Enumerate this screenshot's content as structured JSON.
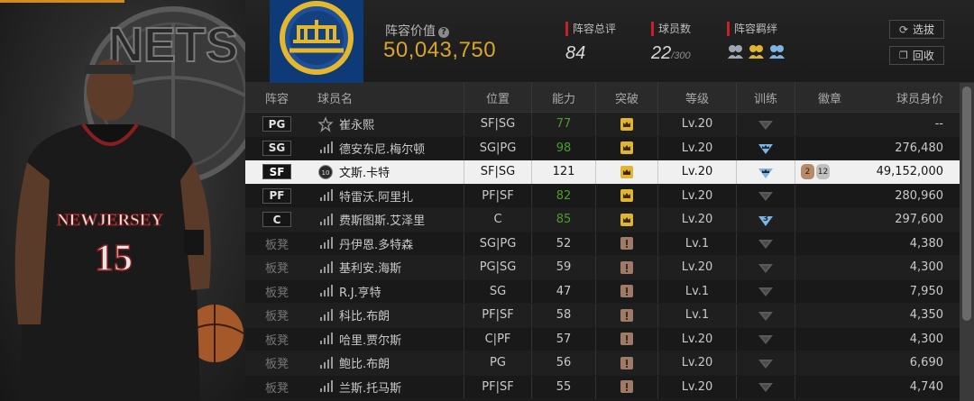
{
  "header": {
    "value_label": "阵容价值",
    "value": "50,043,750",
    "total_rating_label": "阵容总评",
    "total_rating": "84",
    "player_count_label": "球员数",
    "player_count": "22",
    "player_count_max": "/300",
    "bond_label": "阵容羁绊",
    "filter_button": "选拔",
    "recycle_button": "回收"
  },
  "hero": {
    "team_text": "NETS",
    "jersey_team": "NEWJERSEY",
    "jersey_number": "15"
  },
  "table": {
    "headers": [
      "阵容",
      "球员名",
      "位置",
      "能力",
      "突破",
      "等级",
      "训练",
      "徽章",
      "球员身价"
    ],
    "rows": [
      {
        "slot": "PG",
        "name": "崔永熙",
        "pos": "SF|SG",
        "ability": "77",
        "level": "Lv.20",
        "value": "--",
        "ability_color": "green",
        "break": "gold",
        "train": "grey"
      },
      {
        "slot": "SG",
        "name": "德安东尼.梅尔顿",
        "pos": "SG|PG",
        "ability": "98",
        "level": "Lv.20",
        "value": "276,480",
        "ability_color": "green",
        "break": "gold",
        "train": "blue"
      },
      {
        "slot": "SF",
        "name": "文斯.卡特",
        "pos": "SF|SG",
        "ability": "121",
        "level": "Lv.20",
        "value": "49,152,000",
        "ability_color": "dark",
        "break": "gold",
        "train": "blue",
        "selected": true,
        "badges": [
          "2",
          "12"
        ]
      },
      {
        "slot": "PF",
        "name": "特雷沃.阿里扎",
        "pos": "PF|SF",
        "ability": "82",
        "level": "Lv.20",
        "value": "280,960",
        "ability_color": "green",
        "break": "gold",
        "train": "grey"
      },
      {
        "slot": "C",
        "name": "费斯图斯.艾泽里",
        "pos": "C",
        "ability": "85",
        "level": "Lv.20",
        "value": "297,600",
        "ability_color": "green",
        "break": "gold",
        "train": "blue3",
        "train_text": "3"
      },
      {
        "slot": "板凳",
        "name": "丹伊恩.多特森",
        "pos": "SG|PG",
        "ability": "52",
        "level": "Lv.1",
        "value": "4,380",
        "ability_color": "normal",
        "break": "bronze",
        "train": "grey"
      },
      {
        "slot": "板凳",
        "name": "基利安.海斯",
        "pos": "PG|SG",
        "ability": "59",
        "level": "Lv.20",
        "value": "4,300",
        "ability_color": "normal",
        "break": "bronze",
        "train": "grey"
      },
      {
        "slot": "板凳",
        "name": "R.J.亨特",
        "pos": "SG",
        "ability": "47",
        "level": "Lv.1",
        "value": "7,950",
        "ability_color": "normal",
        "break": "bronze",
        "train": "grey"
      },
      {
        "slot": "板凳",
        "name": "科比.布朗",
        "pos": "PF|SF",
        "ability": "58",
        "level": "Lv.1",
        "value": "4,350",
        "ability_color": "normal",
        "break": "bronze",
        "train": "grey"
      },
      {
        "slot": "板凳",
        "name": "哈里.贾尔斯",
        "pos": "C|PF",
        "ability": "57",
        "level": "Lv.20",
        "value": "4,300",
        "ability_color": "normal",
        "break": "bronze",
        "train": "grey"
      },
      {
        "slot": "板凳",
        "name": "鲍比.布朗",
        "pos": "PG",
        "ability": "56",
        "level": "Lv.20",
        "value": "6,690",
        "ability_color": "normal",
        "break": "bronze",
        "train": "grey"
      },
      {
        "slot": "板凳",
        "name": "兰斯.托马斯",
        "pos": "PF|SF",
        "ability": "55",
        "level": "Lv.20",
        "value": "4,740",
        "ability_color": "normal",
        "break": "bronze",
        "train": "grey"
      }
    ]
  },
  "colors": {
    "gold": "#d7a52a",
    "accent_red": "#c4212b",
    "ability_green": "#4c9d2f",
    "train_blue": "#7fb3e0"
  }
}
